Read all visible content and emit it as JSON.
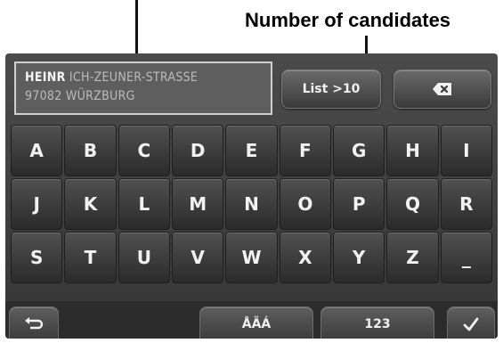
{
  "annotation": {
    "label": "Number of candidates"
  },
  "input": {
    "typed": "HEINR",
    "completion_line1": "ICH-ZEUNER-STRASSE",
    "line2": "97082 WÜRZBURG"
  },
  "buttons": {
    "list_label": "List >10",
    "delete_icon": "backspace-icon",
    "back_icon": "return-arrow-icon",
    "umlaut_label": "ÅÄÁ",
    "numbers_label": "123",
    "ok_icon": "checkmark-icon"
  },
  "keyboard": {
    "keys": [
      "A",
      "B",
      "C",
      "D",
      "E",
      "F",
      "G",
      "H",
      "I",
      "J",
      "K",
      "L",
      "M",
      "N",
      "O",
      "P",
      "Q",
      "R",
      "S",
      "T",
      "U",
      "V",
      "W",
      "X",
      "Y",
      "Z",
      "_"
    ]
  }
}
